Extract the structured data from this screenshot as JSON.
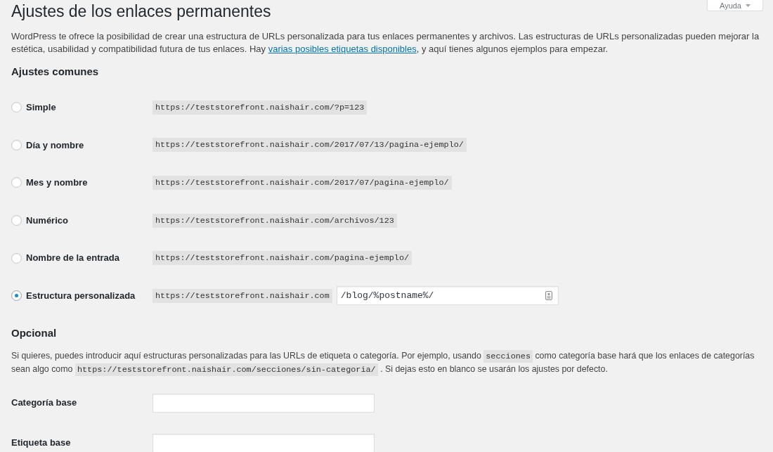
{
  "page": {
    "title": "Ajustes de los enlaces permanentes",
    "help_button": {
      "label": "Ayuda"
    }
  },
  "intro": [
    {
      "kind": "text",
      "text": "WordPress te ofrece la posibilidad de crear una estructura de URLs personalizada para tus enlaces permanentes y archivos. Las estructuras de URLs personalizadas pueden mejorar la estética, usabilidad y compatibilidad futura de tus enlaces. Hay "
    },
    {
      "kind": "link",
      "text": "varias posibles etiquetas disponibles"
    },
    {
      "kind": "text",
      "text": ", y aquí tienes algunos ejemplos para empezar."
    }
  ],
  "common_settings": {
    "heading": "Ajustes comunes",
    "options": [
      {
        "kind": "example",
        "label": "Simple",
        "example": "https://teststorefront.naishair.com/?p=123",
        "selected": false
      },
      {
        "kind": "example",
        "label": "Día y nombre",
        "example": "https://teststorefront.naishair.com/2017/07/13/pagina-ejemplo/",
        "selected": false
      },
      {
        "kind": "example",
        "label": "Mes y nombre",
        "example": "https://teststorefront.naishair.com/2017/07/pagina-ejemplo/",
        "selected": false
      },
      {
        "kind": "example",
        "label": "Numérico",
        "example": "https://teststorefront.naishair.com/archivos/123",
        "selected": false
      },
      {
        "kind": "example",
        "label": "Nombre de la entrada",
        "example": "https://teststorefront.naishair.com/pagina-ejemplo/",
        "selected": false
      },
      {
        "kind": "custom",
        "label": "Estructura personalizada",
        "example": "https://teststorefront.naishair.com",
        "value": "/blog/%postname%/",
        "selected": true
      }
    ]
  },
  "optional": {
    "heading": "Opcional",
    "description": [
      {
        "kind": "text",
        "text": "Si quieres, puedes introducir aquí estructuras personalizadas para las URLs de etiqueta o categoría. Por ejemplo, usando "
      },
      {
        "kind": "code",
        "text": "secciones"
      },
      {
        "kind": "text",
        "text": " como categoría base hará que los enlaces de categorías sean algo como "
      },
      {
        "kind": "code",
        "text": "https://teststorefront.naishair.com/secciones/sin-categoria/"
      },
      {
        "kind": "text",
        "text": " . Si dejas esto en blanco se usarán los ajustes por defecto."
      }
    ],
    "fields": [
      {
        "label": "Categoría base"
      },
      {
        "label": "Etiqueta base"
      }
    ]
  }
}
